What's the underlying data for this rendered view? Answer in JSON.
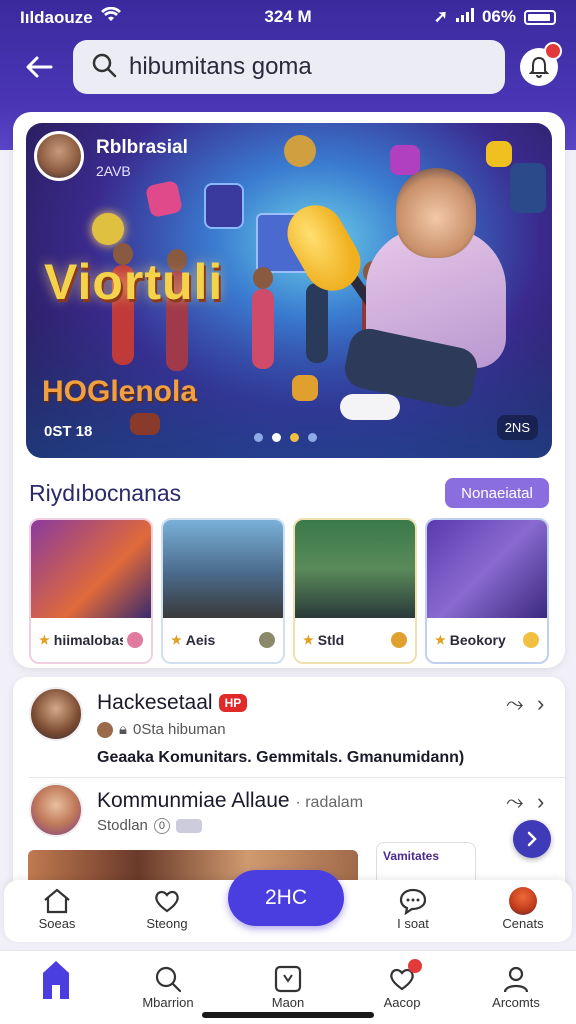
{
  "status_bar": {
    "carrier": "Iıldaouze",
    "time": "324 M",
    "battery": "06%"
  },
  "search": {
    "query": "hibumitans goma"
  },
  "hero": {
    "name": "Rblbrasial",
    "sub": "2AVB",
    "headline": "Viortuli",
    "brand": "HOGlenola",
    "date": "0ST 18",
    "tag": "2NS"
  },
  "section": {
    "title": "Riydıbocnanas",
    "pill": "Nonaeiatal"
  },
  "thumbs": [
    {
      "label": "hiimalobas"
    },
    {
      "label": "Aeis"
    },
    {
      "label": "Stld"
    },
    {
      "label": "Beokory"
    }
  ],
  "list": [
    {
      "title": "Hackesetaal",
      "badge": "HP",
      "meta": "0Sta hibuman",
      "desc": "Geaaka Komunitars. Gemmitals. Gmanumidann)"
    },
    {
      "title": "Kommunmiae Allaue",
      "subtitle": "· radalam",
      "meta": "Stodlan",
      "meta_icon_text": "0",
      "promo": "Vamitates"
    }
  ],
  "toolbar": {
    "items": [
      "Soeas",
      "Steong",
      "I soat",
      "Cenats"
    ],
    "center": "2HC"
  },
  "bottom_nav": {
    "items": [
      "",
      "Mbarrion",
      "Maon",
      "Aacop",
      "Arcomts"
    ]
  },
  "colors": {
    "primary": "#4a3ee0",
    "header": "#3b2a9e",
    "accent": "#8a6ee0",
    "alert": "#e23a3a"
  }
}
